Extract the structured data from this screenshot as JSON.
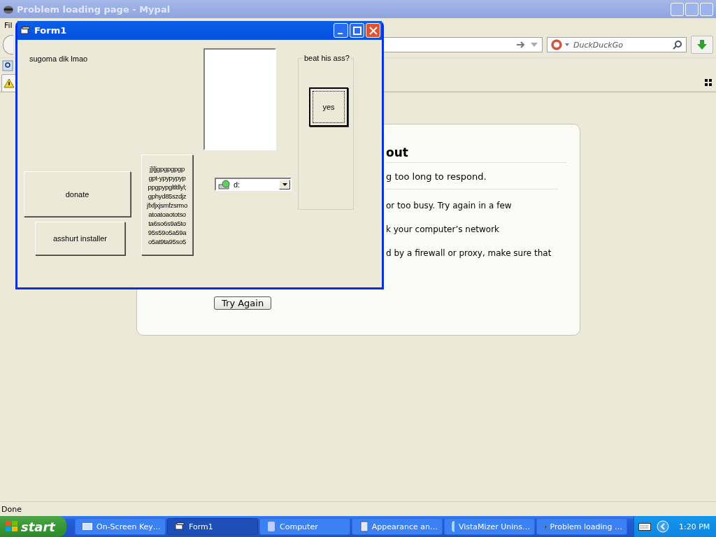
{
  "browser": {
    "title": "Problem loading page - Mypal",
    "menu": [
      "Fil"
    ],
    "search": {
      "placeholder": "DuckDuckGo"
    },
    "error_card": {
      "title": "out",
      "lead": "g too long to respond.",
      "items": [
        "or too busy. Try again in a few",
        "k your computer’s network",
        "d by a firewall or proxy, make sure that"
      ],
      "button": "Try Again"
    },
    "status_bar": "Done"
  },
  "form": {
    "title": "Form1",
    "label": "sugoma dik lmao",
    "group_title": "beat his ass?",
    "yes_button": "yes",
    "donate_button": "donate",
    "installer_button": "asshurt installer",
    "multiline_button": "j]i]jgpgpgpgp\ngpt-ypypypyp\nppgpypgltltllyl;\ngphyd85szdjz\njfxfjxjsmfzsrmo\natoatoaototso\nta6so6s9a5to\n95s59o5a59a\no5at9ta95so5",
    "drive_combo": "d:"
  },
  "taskbar": {
    "start": "start",
    "items": [
      {
        "label": "On-Screen Key…",
        "selected": false
      },
      {
        "label": "Form1",
        "selected": true
      },
      {
        "label": "Computer",
        "selected": false
      },
      {
        "label": "Appearance an…",
        "selected": false
      },
      {
        "label": "VistaMizer Unins…",
        "selected": false
      },
      {
        "label": "Problem loading …",
        "selected": false
      }
    ],
    "clock": "1:20 PM"
  }
}
